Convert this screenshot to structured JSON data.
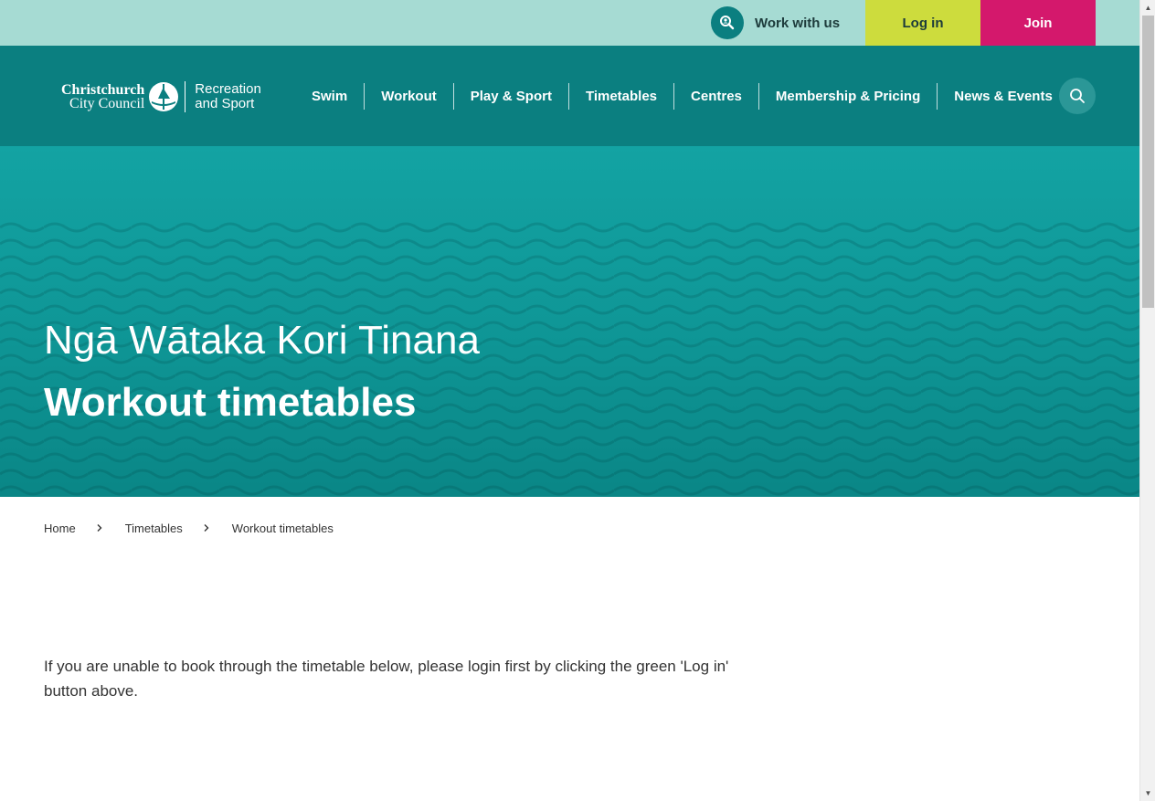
{
  "utility": {
    "work_with_us": "Work with us",
    "login": "Log in",
    "join": "Join"
  },
  "logo": {
    "line1": "Christchurch",
    "line2": "City Council",
    "right1": "Recreation",
    "right2": "and Sport"
  },
  "nav": {
    "items": [
      "Swim",
      "Workout",
      "Play & Sport",
      "Timetables",
      "Centres",
      "Membership & Pricing",
      "News & Events"
    ]
  },
  "hero": {
    "subtitle": "Ngā Wātaka Kori Tinana",
    "title": "Workout timetables"
  },
  "breadcrumb": {
    "items": [
      "Home",
      "Timetables",
      "Workout timetables"
    ]
  },
  "content": {
    "notice": "If you are unable to book through the timetable below, please login first by clicking the green 'Log in' button above."
  },
  "colors": {
    "utility_bar": "#a6dbd3",
    "nav_bar": "#0b7f80",
    "login_button": "#cddc3d",
    "join_button": "#d4186c",
    "hero": "#13a3a3"
  },
  "icons": {
    "work_with_us": "magnifier-person-icon",
    "search": "search-icon",
    "breadcrumb_separator": "chevron-right-icon",
    "logo_mark": "cathedral-icon"
  }
}
